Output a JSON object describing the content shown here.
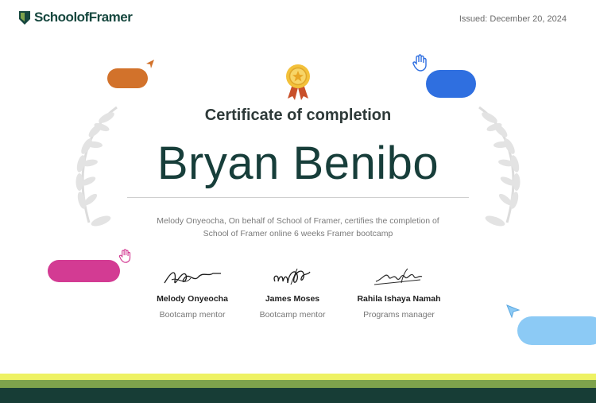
{
  "brand": {
    "name": "SchoolofFramer",
    "color": "#17483f"
  },
  "issued": "Issued: December 20, 2024",
  "certificate": {
    "title": "Certificate of completion",
    "recipient": "Bryan Benibo",
    "statement": "Melody Onyeocha, On behalf of School of Framer, certifies the completion of School of Framer online 6 weeks Framer bootcamp"
  },
  "signers": [
    {
      "name": "Melody Onyeocha",
      "role": "Bootcamp mentor"
    },
    {
      "name": "James Moses",
      "role": "Bootcamp mentor"
    },
    {
      "name": "Rahila Ishaya Namah",
      "role": "Programs manager"
    }
  ],
  "decorations": {
    "icons": [
      "shield-logo-icon",
      "medal-icon",
      "laurel-left-icon",
      "laurel-right-icon",
      "hand-cursor-icon",
      "arrow-cursor-icon"
    ],
    "colors": {
      "orange": "#d2722b",
      "blue": "#2f6fe0",
      "pink": "#d33b93",
      "sky": "#8ccaf5",
      "yellow_band": "#eef263",
      "green_band": "#7ea34c",
      "dark_band": "#173d36"
    }
  }
}
